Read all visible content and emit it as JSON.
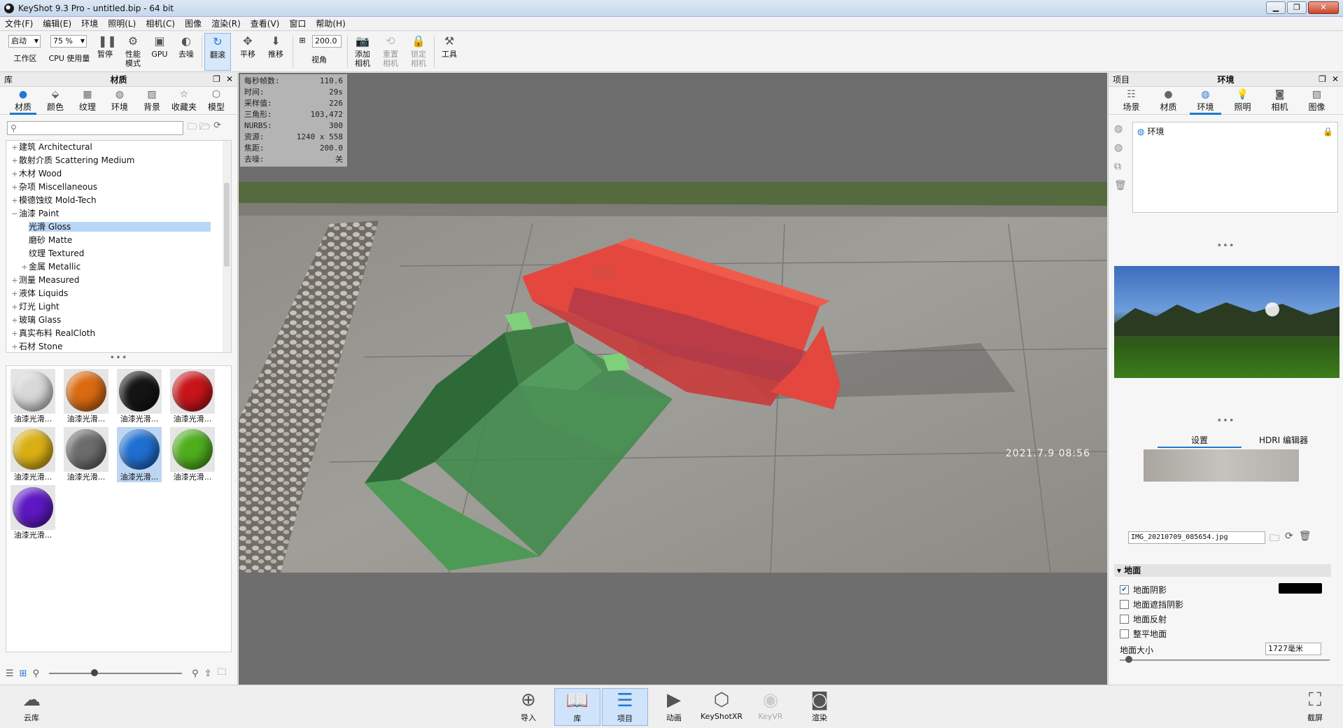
{
  "window": {
    "title": "KeyShot 9.3 Pro - untitled.bip - 64 bit"
  },
  "menu": [
    "文件(F)",
    "编辑(E)",
    "环境",
    "照明(L)",
    "相机(C)",
    "图像",
    "渲染(R)",
    "查看(V)",
    "窗口",
    "帮助(H)"
  ],
  "toolbar": {
    "startup_value": "启动",
    "workspace_label": "工作区",
    "cpu_value": "75 %",
    "cpu_label": "CPU 使用量",
    "pause_label": "暂停",
    "perf_label": "性能\n模式",
    "gpu_label": "GPU",
    "denoise_label": "去噪",
    "tumble_label": "翻滚",
    "pan_label": "平移",
    "dolly_label": "推移",
    "fov_value": "200.0",
    "fov_label": "视角",
    "add_camera_label": "添加\n相机",
    "reset_camera_label": "重置\n相机",
    "lock_camera_label": "锁定\n相机",
    "tools_label": "工具"
  },
  "library": {
    "panel_left_title": "库",
    "panel_title": "材质",
    "tabs": [
      "材质",
      "颜色",
      "纹理",
      "环境",
      "背景",
      "收藏夹",
      "模型"
    ],
    "active_tab": "材质",
    "search_placeholder": "",
    "tree": [
      {
        "label": "建筑 Architectural",
        "level": 0,
        "expander": "+"
      },
      {
        "label": "散射介质 Scattering Medium",
        "level": 0,
        "expander": "+"
      },
      {
        "label": "木材 Wood",
        "level": 0,
        "expander": "+"
      },
      {
        "label": "杂项 Miscellaneous",
        "level": 0,
        "expander": "+"
      },
      {
        "label": "模德蚀纹 Mold-Tech",
        "level": 0,
        "expander": "+"
      },
      {
        "label": "油漆 Paint",
        "level": 0,
        "expander": "−"
      },
      {
        "label": "光滑 Gloss",
        "level": 1,
        "expander": "",
        "selected": true
      },
      {
        "label": "磨砂 Matte",
        "level": 1,
        "expander": ""
      },
      {
        "label": "纹理 Textured",
        "level": 1,
        "expander": ""
      },
      {
        "label": "金属 Metallic",
        "level": 1,
        "expander": "+"
      },
      {
        "label": "测量 Measured",
        "level": 0,
        "expander": "+"
      },
      {
        "label": "液体 Liquids",
        "level": 0,
        "expander": "+"
      },
      {
        "label": "灯光 Light",
        "level": 0,
        "expander": "+"
      },
      {
        "label": "玻璃 Glass",
        "level": 0,
        "expander": "+"
      },
      {
        "label": "真实布料 RealCloth",
        "level": 0,
        "expander": "+"
      },
      {
        "label": "石材 Stone",
        "level": 0,
        "expander": "+"
      }
    ],
    "thumbnails": [
      {
        "caption": "油漆光滑...",
        "color": "#d8d8d8"
      },
      {
        "caption": "油漆光滑...",
        "color": "#d96a10"
      },
      {
        "caption": "油漆光滑...",
        "color": "#141414"
      },
      {
        "caption": "油漆光滑...",
        "color": "#c8141a"
      },
      {
        "caption": "油漆光滑...",
        "color": "#d9b014"
      },
      {
        "caption": "油漆光滑...",
        "color": "#6c6c6c"
      },
      {
        "caption": "油漆光滑...",
        "color": "#1f6fd0",
        "selected": true
      },
      {
        "caption": "油漆光滑...",
        "color": "#4fae1c"
      },
      {
        "caption": "油漆光滑...",
        "color": "#5d18c4"
      }
    ]
  },
  "stats": [
    {
      "k": "每秒帧数:",
      "v": "110.6"
    },
    {
      "k": "时间:",
      "v": "29s"
    },
    {
      "k": "采样值:",
      "v": "226"
    },
    {
      "k": "三角形:",
      "v": "103,472"
    },
    {
      "k": "NURBS:",
      "v": "300"
    },
    {
      "k": "资源:",
      "v": "1240 x 558"
    },
    {
      "k": "焦距:",
      "v": "200.0"
    },
    {
      "k": "去噪:",
      "v": "关"
    }
  ],
  "viewport": {
    "timestamp": "2021.7.9 08:56"
  },
  "project": {
    "panel_left_title": "项目",
    "panel_title": "环境",
    "tabs": [
      "场景",
      "材质",
      "环境",
      "照明",
      "相机",
      "图像"
    ],
    "active_tab": "环境",
    "env_item": "环境",
    "subtabs": [
      "设置",
      "HDRI 编辑器"
    ],
    "file_name": "IMG_20210709_085654.jpg",
    "section_ground": "地面",
    "ground_shadow": "地面阴影",
    "ground_occlusion": "地面遮挡阴影",
    "ground_reflection": "地面反射",
    "flatten_ground": "整平地面",
    "ground_size_label": "地面大小",
    "ground_size_value": "1727毫米",
    "ground_shadow_color": "#000000"
  },
  "bottom": {
    "cloud": "云库",
    "import": "导入",
    "library": "库",
    "project": "项目",
    "animation": "动画",
    "keyshotxr": "KeyShotXR",
    "keyvr": "KeyVR",
    "render": "渲染",
    "screenshot": "截屏"
  }
}
